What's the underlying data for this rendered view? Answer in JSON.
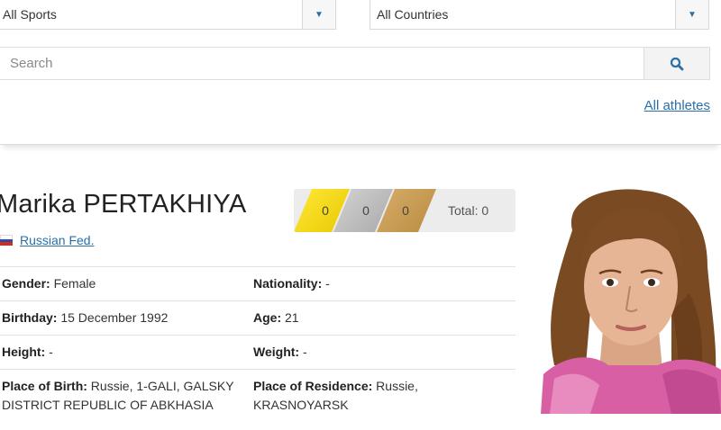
{
  "filters": {
    "sports_selected": "All Sports",
    "countries_selected": "All Countries",
    "search_placeholder": "Search",
    "all_athletes_link": "All athletes"
  },
  "athlete": {
    "name": "Marika PERTAKHIYA",
    "country": "Russian Fed.",
    "medals": {
      "gold": "0",
      "silver": "0",
      "bronze": "0",
      "total": "Total: 0"
    },
    "fields": {
      "gender_label": "Gender:",
      "gender_value": "Female",
      "nationality_label": "Nationality:",
      "nationality_value": "-",
      "birthday_label": "Birthday:",
      "birthday_value": "15 December 1992",
      "age_label": "Age:",
      "age_value": "21",
      "height_label": "Height:",
      "height_value": "-",
      "weight_label": "Weight:",
      "weight_value": "-",
      "birthplace_label": "Place of Birth:",
      "birthplace_value": "Russie, 1-GALI, GALSKY DISTRICT REPUBLIC OF ABKHASIA",
      "residence_label": "Place of Residence:",
      "residence_value": "Russie, KRASNOYARSK"
    }
  },
  "colors": {
    "link": "#2a6fa8",
    "gold": "#f5dd10",
    "silver": "#bdbdbd",
    "bronze": "#c99b52"
  },
  "icons": {
    "dropdown": "chevron-down-icon",
    "search": "search-icon",
    "flag": "russia-flag-icon"
  }
}
